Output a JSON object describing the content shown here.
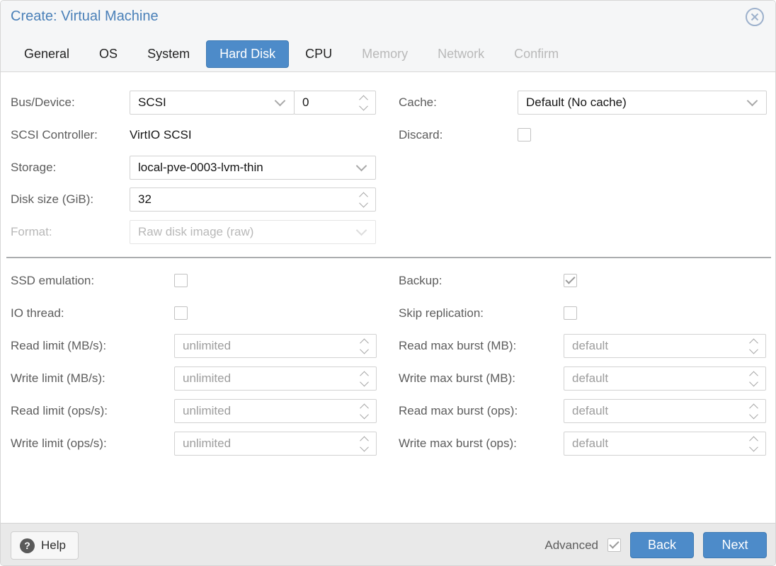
{
  "window": {
    "title": "Create: Virtual Machine"
  },
  "tabs": [
    {
      "label": "General"
    },
    {
      "label": "OS"
    },
    {
      "label": "System"
    },
    {
      "label": "Hard Disk",
      "active": true
    },
    {
      "label": "CPU"
    },
    {
      "label": "Memory",
      "disabled": true
    },
    {
      "label": "Network",
      "disabled": true
    },
    {
      "label": "Confirm",
      "disabled": true
    }
  ],
  "form": {
    "bus_device": {
      "label": "Bus/Device:",
      "value": "SCSI",
      "index": "0"
    },
    "scsi_controller": {
      "label": "SCSI Controller:",
      "value": "VirtIO SCSI"
    },
    "storage": {
      "label": "Storage:",
      "value": "local-pve-0003-lvm-thin"
    },
    "disk_size": {
      "label": "Disk size (GiB):",
      "value": "32"
    },
    "format": {
      "label": "Format:",
      "value": "Raw disk image (raw)",
      "disabled": true
    },
    "cache": {
      "label": "Cache:",
      "value": "Default (No cache)"
    },
    "discard": {
      "label": "Discard:",
      "checked": false
    },
    "ssd_emulation": {
      "label": "SSD emulation:",
      "checked": false
    },
    "io_thread": {
      "label": "IO thread:",
      "checked": false
    },
    "backup": {
      "label": "Backup:",
      "checked": true
    },
    "skip_replication": {
      "label": "Skip replication:",
      "checked": false
    },
    "read_limit_mb": {
      "label": "Read limit (MB/s):",
      "placeholder": "unlimited"
    },
    "write_limit_mb": {
      "label": "Write limit (MB/s):",
      "placeholder": "unlimited"
    },
    "read_limit_ops": {
      "label": "Read limit (ops/s):",
      "placeholder": "unlimited"
    },
    "write_limit_ops": {
      "label": "Write limit (ops/s):",
      "placeholder": "unlimited"
    },
    "read_burst_mb": {
      "label": "Read max burst (MB):",
      "placeholder": "default"
    },
    "write_burst_mb": {
      "label": "Write max burst (MB):",
      "placeholder": "default"
    },
    "read_burst_ops": {
      "label": "Read max burst (ops):",
      "placeholder": "default"
    },
    "write_burst_ops": {
      "label": "Write max burst (ops):",
      "placeholder": "default"
    }
  },
  "footer": {
    "help_label": "Help",
    "advanced_label": "Advanced",
    "advanced_checked": true,
    "back_label": "Back",
    "next_label": "Next"
  },
  "icons": {
    "help_glyph": "?"
  },
  "colors": {
    "accent_blue": "#4d8bc9",
    "title_blue": "#4a80b8"
  }
}
